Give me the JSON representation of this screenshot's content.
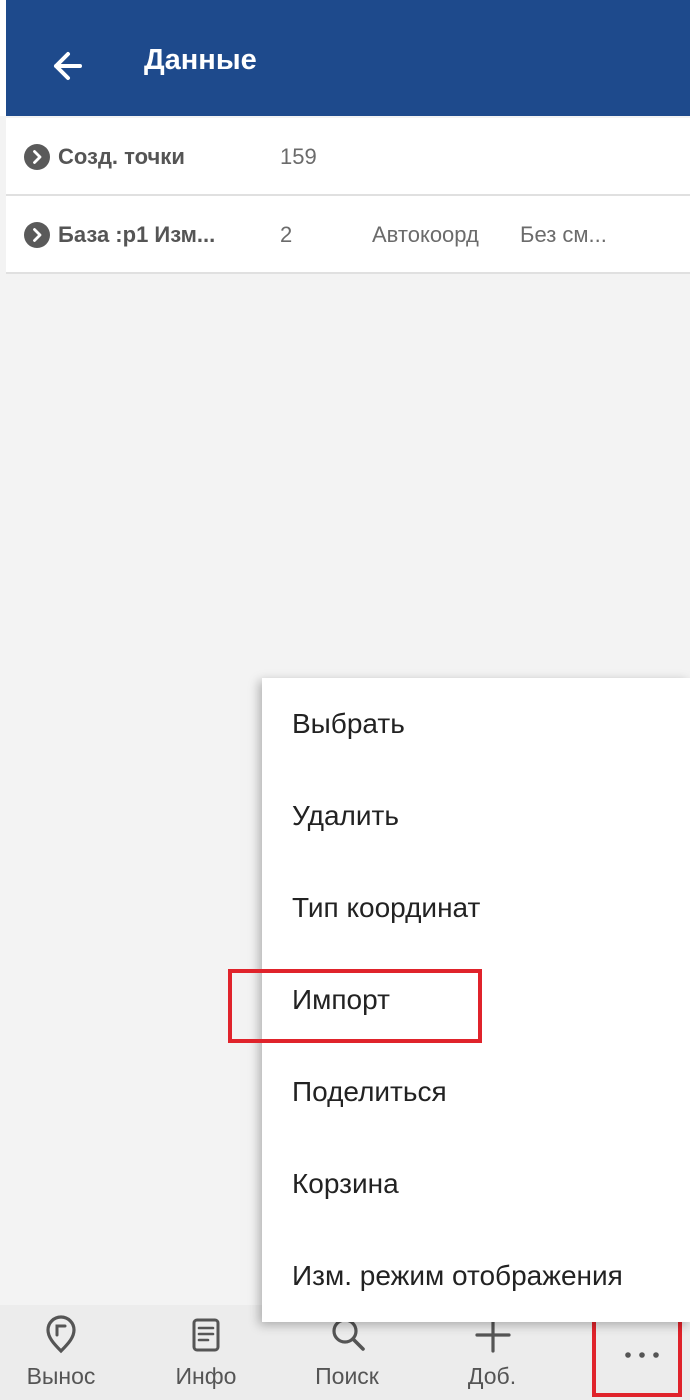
{
  "header": {
    "title": "Данные"
  },
  "rows": [
    {
      "name": "Созд. точки",
      "count": "159",
      "extra1": "",
      "extra2": ""
    },
    {
      "name": "База :p1 Изм...",
      "count": "2",
      "extra1": "Автокоорд",
      "extra2": "Без см..."
    }
  ],
  "menu": {
    "items": [
      "Выбрать",
      "Удалить",
      "Тип координат",
      "Импорт",
      "Поделиться",
      "Корзина",
      "Изм. режим отображения"
    ],
    "highlighted_item": "Импорт"
  },
  "bottom_nav": {
    "items": [
      {
        "label": "Вынос",
        "icon": "stakeout-pin-icon"
      },
      {
        "label": "Инфо",
        "icon": "info-document-icon"
      },
      {
        "label": "Поиск",
        "icon": "search-icon"
      },
      {
        "label": "Доб.",
        "icon": "plus-icon"
      },
      {
        "label": "",
        "icon": "more-dots-icon"
      }
    ]
  },
  "colors": {
    "header_bg": "#1e4a8c",
    "highlight_border": "#e0232b",
    "background": "#f3f3f3"
  }
}
